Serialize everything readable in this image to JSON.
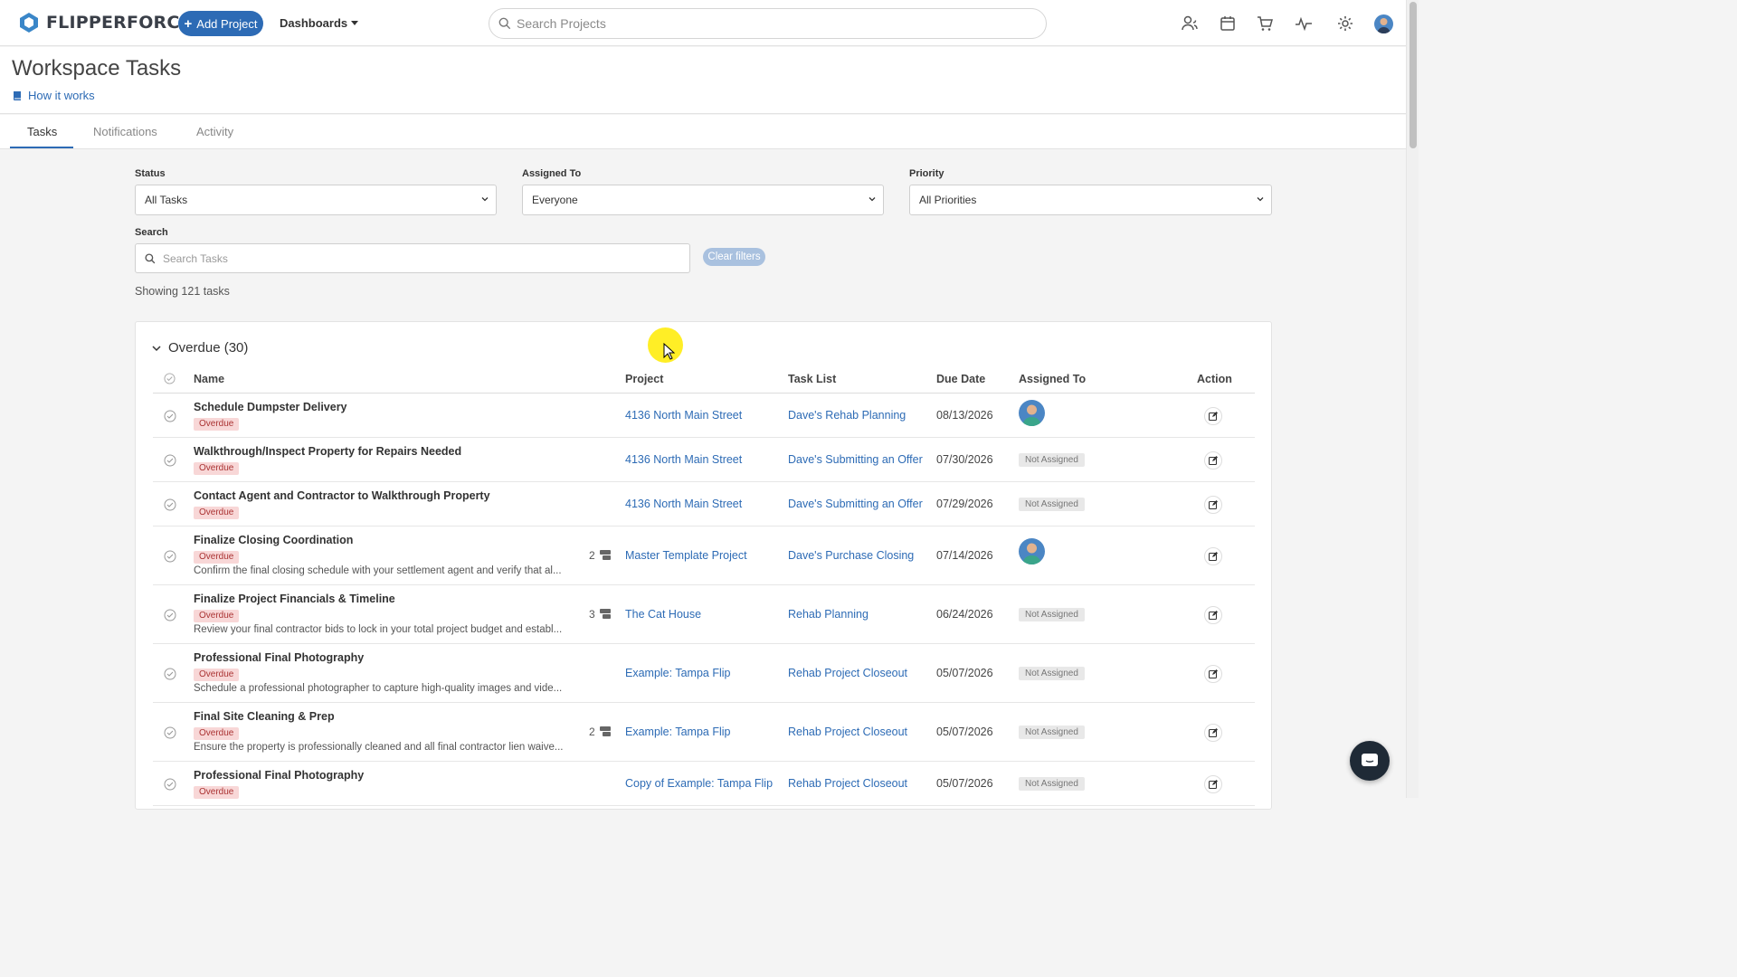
{
  "app": {
    "brand": "FLIPPERFORCE",
    "accent": "#2d6bb5"
  },
  "topnav": {
    "add_project_label": "Add Project",
    "dashboards_label": "Dashboards",
    "search_placeholder": "Search Projects",
    "icons": [
      "users-icon",
      "calendar-icon",
      "cart-icon",
      "activity-icon",
      "gear-icon",
      "user-avatar"
    ]
  },
  "header": {
    "title": "Workspace Tasks",
    "how_it_works": "How it works"
  },
  "tabs": [
    {
      "label": "Tasks",
      "active": true
    },
    {
      "label": "Notifications",
      "active": false
    },
    {
      "label": "Activity",
      "active": false
    }
  ],
  "filters": {
    "status_label": "Status",
    "status_value": "All Tasks",
    "assigned_label": "Assigned To",
    "assigned_value": "Everyone",
    "priority_label": "Priority",
    "priority_value": "All Priorities",
    "search_label": "Search",
    "search_placeholder": "Search Tasks",
    "clear_label": "Clear filters",
    "showing": "Showing 121 tasks"
  },
  "group": {
    "title": "Overdue (30)",
    "columns": {
      "name": "Name",
      "project": "Project",
      "task_list": "Task List",
      "due_date": "Due Date",
      "assigned_to": "Assigned To",
      "action": "Action"
    }
  },
  "tasks": [
    {
      "name": "Schedule Dumpster Delivery",
      "badge": "Overdue",
      "desc": "",
      "comments": "",
      "project": "4136 North Main Street",
      "task_list": "Dave's Rehab Planning",
      "due": "08/13/2026",
      "assigned": "",
      "has_avatar": true
    },
    {
      "name": "Walkthrough/Inspect Property for Repairs Needed",
      "badge": "Overdue",
      "desc": "",
      "comments": "",
      "project": "4136 North Main Street",
      "task_list": "Dave's Submitting an Offer",
      "due": "07/30/2026",
      "assigned": "Not Assigned",
      "has_avatar": false
    },
    {
      "name": "Contact Agent and Contractor to Walkthrough Property",
      "badge": "Overdue",
      "desc": "",
      "comments": "",
      "project": "4136 North Main Street",
      "task_list": "Dave's Submitting an Offer",
      "due": "07/29/2026",
      "assigned": "Not Assigned",
      "has_avatar": false
    },
    {
      "name": "Finalize Closing Coordination",
      "badge": "Overdue",
      "desc": "Confirm the final closing schedule with your settlement agent and verify that al...",
      "comments": "2",
      "project": "Master Template Project",
      "task_list": "Dave's Purchase Closing",
      "due": "07/14/2026",
      "assigned": "",
      "has_avatar": true
    },
    {
      "name": "Finalize Project Financials & Timeline",
      "badge": "Overdue",
      "desc": "Review your final contractor bids to lock in your total project budget and establ...",
      "comments": "3",
      "project": "The Cat House",
      "task_list": "Rehab Planning",
      "due": "06/24/2026",
      "assigned": "Not Assigned",
      "has_avatar": false
    },
    {
      "name": "Professional Final Photography",
      "badge": "Overdue",
      "desc": "Schedule a professional photographer to capture high-quality images and vide...",
      "comments": "",
      "project": "Example: Tampa Flip",
      "task_list": "Rehab Project Closeout",
      "due": "05/07/2026",
      "assigned": "Not Assigned",
      "has_avatar": false
    },
    {
      "name": "Final Site Cleaning & Prep",
      "badge": "Overdue",
      "desc": "Ensure the property is professionally cleaned and all final contractor lien waive...",
      "comments": "2",
      "project": "Example: Tampa Flip",
      "task_list": "Rehab Project Closeout",
      "due": "05/07/2026",
      "assigned": "Not Assigned",
      "has_avatar": false
    },
    {
      "name": "Professional Final Photography",
      "badge": "Overdue",
      "desc": "",
      "comments": "",
      "project": "Copy of Example: Tampa Flip",
      "task_list": "Rehab Project Closeout",
      "due": "05/07/2026",
      "assigned": "Not Assigned",
      "has_avatar": false
    }
  ]
}
